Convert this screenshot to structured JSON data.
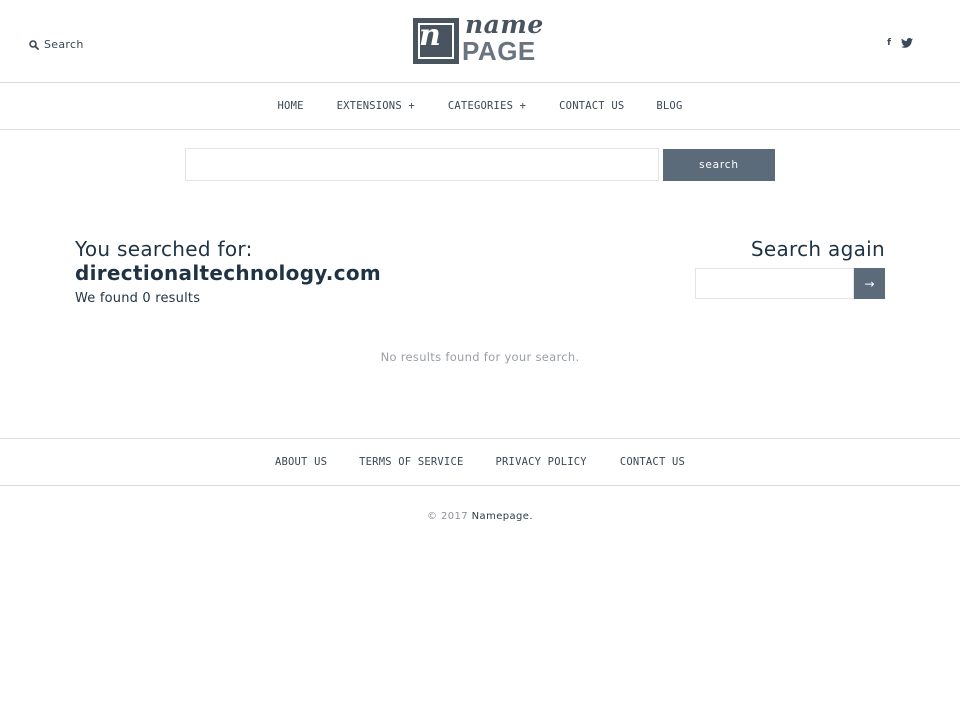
{
  "header": {
    "search_label": "Search",
    "logo": {
      "top_word": "name",
      "bottom_word": "PAGE",
      "mark_glyph": "n"
    },
    "social": {
      "facebook": "f",
      "twitter_icon": "twitter-icon"
    }
  },
  "nav": {
    "items": [
      {
        "label": "HOME"
      },
      {
        "label": "EXTENSIONS +"
      },
      {
        "label": "CATEGORIES +"
      },
      {
        "label": "CONTACT US"
      },
      {
        "label": "BLOG"
      }
    ]
  },
  "main_search": {
    "value": "",
    "button_label": "search"
  },
  "results": {
    "heading": "You searched for:",
    "query": "directionaltechnology.com",
    "count_text": "We found 0 results",
    "empty_message": "No results found for your search."
  },
  "search_again": {
    "title": "Search again",
    "value": "",
    "button_label": "→"
  },
  "footer": {
    "links": [
      {
        "label": "ABOUT US"
      },
      {
        "label": "TERMS OF SERVICE"
      },
      {
        "label": "PRIVACY POLICY"
      },
      {
        "label": "CONTACT US"
      }
    ],
    "copyright_prefix": "© 2017",
    "copyright_link": "Namepage."
  },
  "colors": {
    "accent": "#5c6b7a",
    "heading": "#1f3344",
    "border": "#dcdcdc",
    "muted": "#9a9fa5"
  }
}
